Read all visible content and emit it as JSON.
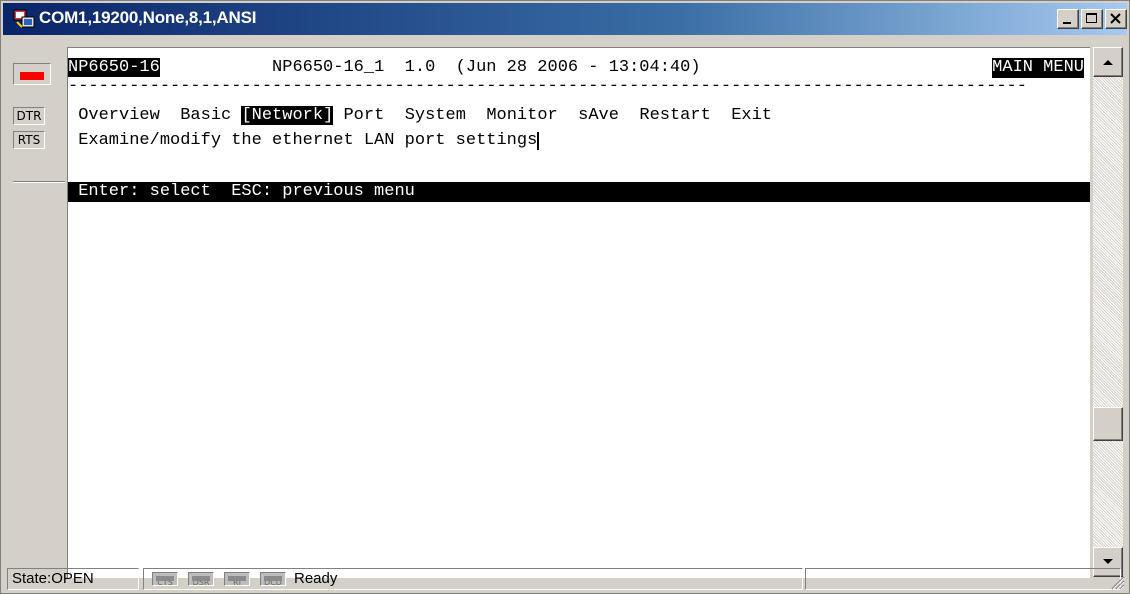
{
  "window": {
    "title": "COM1,19200,None,8,1,ANSI"
  },
  "signals": {
    "dtr": "DTR",
    "rts": "RTS"
  },
  "terminal": {
    "device": "NP6650-16",
    "header_info": "NP6650-16_1  1.0  (Jun 28 2006 - 13:04:40)",
    "menu_title": "MAIN MENU",
    "separator": "----------------------------------------------------------------------------------------------",
    "menu_items": [
      {
        "label": "Overview"
      },
      {
        "label": "Basic"
      },
      {
        "label": "[Network]",
        "selected": true
      },
      {
        "label": "Port"
      },
      {
        "label": "System"
      },
      {
        "label": "Monitor"
      },
      {
        "label": "sAve"
      },
      {
        "label": "Restart"
      },
      {
        "label": "Exit"
      }
    ],
    "description": "Examine/modify the ethernet LAN port settings",
    "help_line": "Enter: select  ESC: previous menu"
  },
  "status": {
    "state": "State:OPEN",
    "indicators": [
      "CTS",
      "DSR",
      "RI",
      "DCD"
    ],
    "message": "Ready"
  },
  "colors": {
    "titlebar_start": "#0a246a",
    "titlebar_end": "#a6caf0",
    "led": "#ff0000",
    "terminal_bg": "#ffffff"
  }
}
